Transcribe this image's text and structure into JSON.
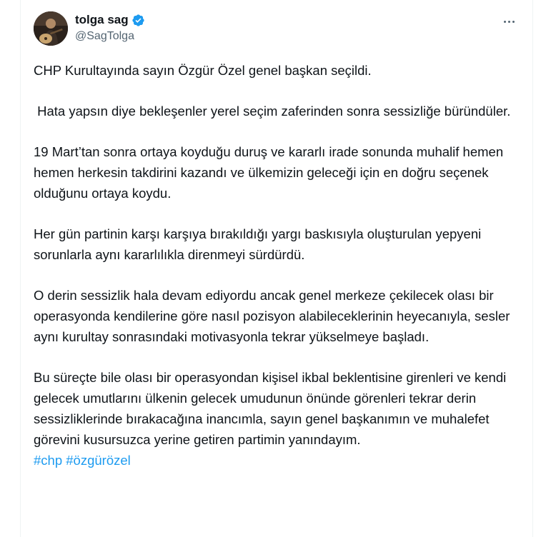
{
  "author": {
    "display_name": "tolga sag",
    "handle": "@SagTolga",
    "verified": true,
    "avatar_icon": "profile-photo-guitarist"
  },
  "menu": {
    "icon": "more-horizontal-icon"
  },
  "tweet": {
    "paragraphs": [
      "CHP Kurultayında sayın Özgür Özel genel başkan seçildi.",
      " Hata yapsın diye bekleşenler yerel seçim zaferinden sonra sessizliğe büründüler.",
      "19 Mart’tan sonra ortaya koyduğu duruş ve kararlı irade sonunda muhalif hemen hemen herkesin takdirini kazandı ve ülkemizin geleceği için en doğru seçenek olduğunu ortaya koydu.",
      "Her gün partinin karşı karşıya bırakıldığı yargı baskısıyla oluşturulan yepyeni sorunlarla aynı kararlılıkla direnmeyi sürdürdü.",
      "O derin sessizlik hala devam ediyordu ancak genel merkeze çekilecek olası bir operasyonda kendilerine göre nasıl pozisyon alabileceklerinin heyecanıyla, sesler aynı kurultay sonrasındaki motivasyonla tekrar yükselmeye başladı.",
      "Bu süreçte bile olası bir operasyondan kişisel ikbal beklentisine girenleri ve kendi gelecek umutlarını ülkenin gelecek umudunun önünde görenleri tekrar derin sessizliklerinde bırakacağına inancımla, sayın genel başkanımın ve muhalefet görevini kusursuzca yerine getiren partimin yanındayım."
    ],
    "hashtags": [
      "#chp",
      "#özgürözel"
    ]
  },
  "colors": {
    "text": "#0f1419",
    "secondary": "#536471",
    "link": "#1d9bf0",
    "verified": "#1d9bf0"
  }
}
